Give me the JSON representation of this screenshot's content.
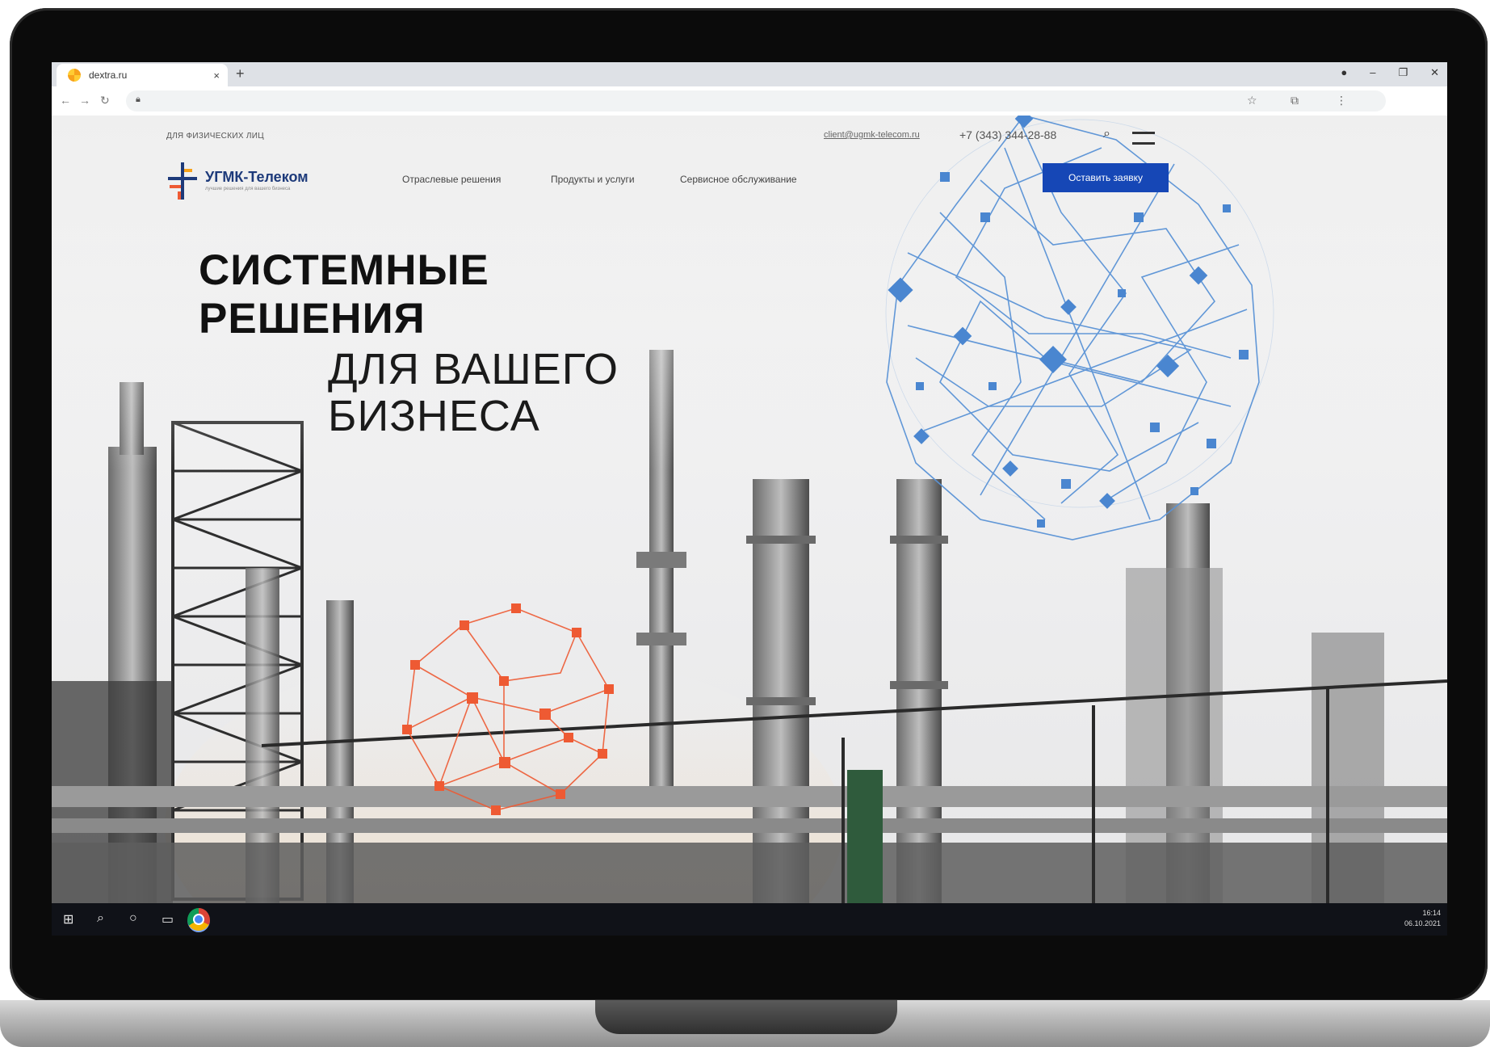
{
  "browser": {
    "tab_title": "dextra.ru",
    "tab_close": "×",
    "new_tab": "+",
    "window_controls": [
      "●",
      "–",
      "❐",
      "✕"
    ]
  },
  "site": {
    "top_link": "ДЛЯ ФИЗИЧЕСКИХ ЛИЦ",
    "email": "client@ugmk-telecom.ru",
    "phone": "+7 (343) 344-28-88",
    "logo_name": "УГМК-Телеком",
    "logo_tagline": "лучшие решения для вашего бизнеса",
    "nav": [
      "Отраслевые решения",
      "Продукты и услуги",
      "Сервисное обслуживание"
    ],
    "cta": "Оставить заявку",
    "headline_bold_1": "СИСТЕМНЫЕ",
    "headline_bold_2": "РЕШЕНИЯ",
    "headline_thin_1": "ДЛЯ ВАШЕГО",
    "headline_thin_2": "БИЗНЕСА"
  },
  "taskbar": {
    "time": "16:14",
    "date": "06.10.2021"
  },
  "colors": {
    "accent_blue": "#1647b6",
    "network_blue": "#4a86d0",
    "network_orange": "#ee5a33"
  },
  "icons": [
    "favicon-icon",
    "back-icon",
    "forward-icon",
    "reload-icon",
    "lock-icon",
    "star-icon",
    "extensions-icon",
    "more-icon",
    "search-icon",
    "menu-icon",
    "windows-start-icon",
    "cortana-icon",
    "task-view-icon",
    "chrome-icon"
  ]
}
